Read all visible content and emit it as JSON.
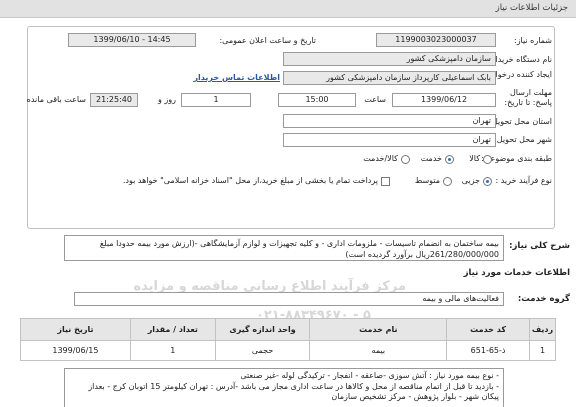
{
  "page_title": "جزئیات اطلاعات نیاز",
  "labels": {
    "need_number": "شماره نیاز:",
    "announce_datetime": "تاریخ و ساعت اعلان عمومی:",
    "buyer_org": "نام دستگاه خریدار:",
    "creator": "ایجاد کننده درخواست:",
    "deadline": "مهلت ارسال پاسخ: تا تاریخ:",
    "time": "ساعت",
    "day_and": "روز و",
    "remaining": "ساعت باقی مانده",
    "province": "استان محل تحویل:",
    "city": "شهر محل تحویل:",
    "category": "طبقه بندی موضوعی:",
    "process_type": "نوع فرآیند خرید :",
    "general_description": "شرح کلی نیاز:",
    "services_info": "اطلاعات خدمات مورد نیاز",
    "service_group": "گروه خدمت:"
  },
  "values": {
    "need_number": "1199003023000037",
    "announce_datetime": "1399/06/10 - 14:45",
    "buyer_org": "سازمان دامپزشکی کشور",
    "creator": "بابک اسماعیلی کارپرداز سازمان دامپزشکی کشور",
    "contact_link": "اطلاعات تماس خریدار",
    "deadline_date": "1399/06/12",
    "deadline_time": "15:00",
    "days": "1",
    "remaining_time": "21:25:40",
    "province": "تهران",
    "city": "تهران",
    "service_group": "فعالیت‌های مالی و بیمه"
  },
  "category_options": [
    {
      "label": "کالا",
      "selected": false
    },
    {
      "label": "خدمت",
      "selected": true
    },
    {
      "label": "کالا/خدمت",
      "selected": false
    }
  ],
  "process_options": [
    {
      "label": "جزیی",
      "selected": true
    },
    {
      "label": "متوسط",
      "selected": false
    }
  ],
  "payment_note": "پرداخت تمام یا بخشی از مبلغ خرید،از محل \"اسناد خزانه اسلامی\" خواهد بود.",
  "description": "بیمه ساختمان به انضمام تاسیسات - ملزومات اداری - و کلیه تجهیزات و لوازم آزمایشگاهی -(ارزش مورد بیمه حدودا مبلغ 261/280/000/000ریال برآورد گردیده است)",
  "watermark": {
    "line1": "مرکز فرآیند اطلاع رسانی مناقصه و مزایده",
    "line2": "۰۲۱-۸۸۳۴۹۶۷۰ - ۵"
  },
  "table": {
    "headers": [
      "ردیف",
      "کد خدمت",
      "نام خدمت",
      "واحد اندازه گیری",
      "تعداد / مقدار",
      "تاریخ نیاز"
    ],
    "rows": [
      [
        "1",
        "ذ-65-651",
        "بیمه",
        "حجمی",
        "1",
        "1399/06/15"
      ]
    ]
  },
  "notes": "- نوع بیمه مورد نیاز : آتش سوزی -صاعقه - انفجار - ترکیدگی لوله -غیر صنعتی\n- بازدید تا قبل از اتمام مناقصه از محل و کالاها در ساعت اداری مجاز می باشد -آدرس : تهران کیلومتر 15 اتوبان کرج - بعداز پیکان شهر - بلوار پژوهش - مرکز تشخیص سازمان"
}
